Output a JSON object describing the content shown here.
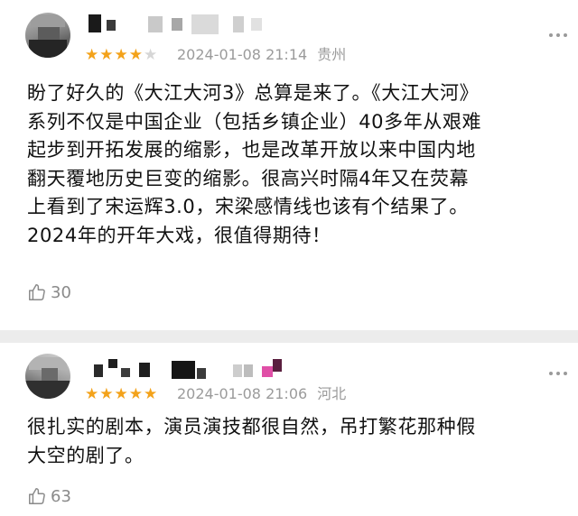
{
  "comments": [
    {
      "rating": 4,
      "rating_max": 5,
      "timestamp": "2024-01-08 21:14",
      "location": "贵州",
      "text_lines": [
        "盼了好久的《大江大河3》总算是来了。《大江大河》",
        "系列不仅是中国企业（包括乡镇企业）40多年从艰难",
        "起步到开拓发展的缩影，也是改革开放以来中国内地",
        "翻天覆地历史巨变的缩影。很高兴时隔4年又在荧幕",
        "上看到了宋运辉3.0，宋梁感情线也该有个结果了。",
        "2024年的开年大戏，很值得期待！"
      ],
      "likes": "30",
      "icons": {
        "more": "more-dots-icon",
        "like": "thumbs-up-icon",
        "star": "star-icon"
      }
    },
    {
      "rating": 5,
      "rating_max": 5,
      "timestamp": "2024-01-08 21:06",
      "location": "河北",
      "text_lines": [
        "很扎实的剧本，演员演技都很自然，吊打繁花那种假",
        "大空的剧了。"
      ],
      "likes": "63",
      "icons": {
        "more": "more-dots-icon",
        "like": "thumbs-up-icon",
        "star": "star-icon"
      }
    }
  ],
  "colors": {
    "star_on": "#f3a21a",
    "star_off": "#d6d6d6",
    "meta_text": "#9b9b9b",
    "body_text": "#111111",
    "separator": "#ececec"
  }
}
